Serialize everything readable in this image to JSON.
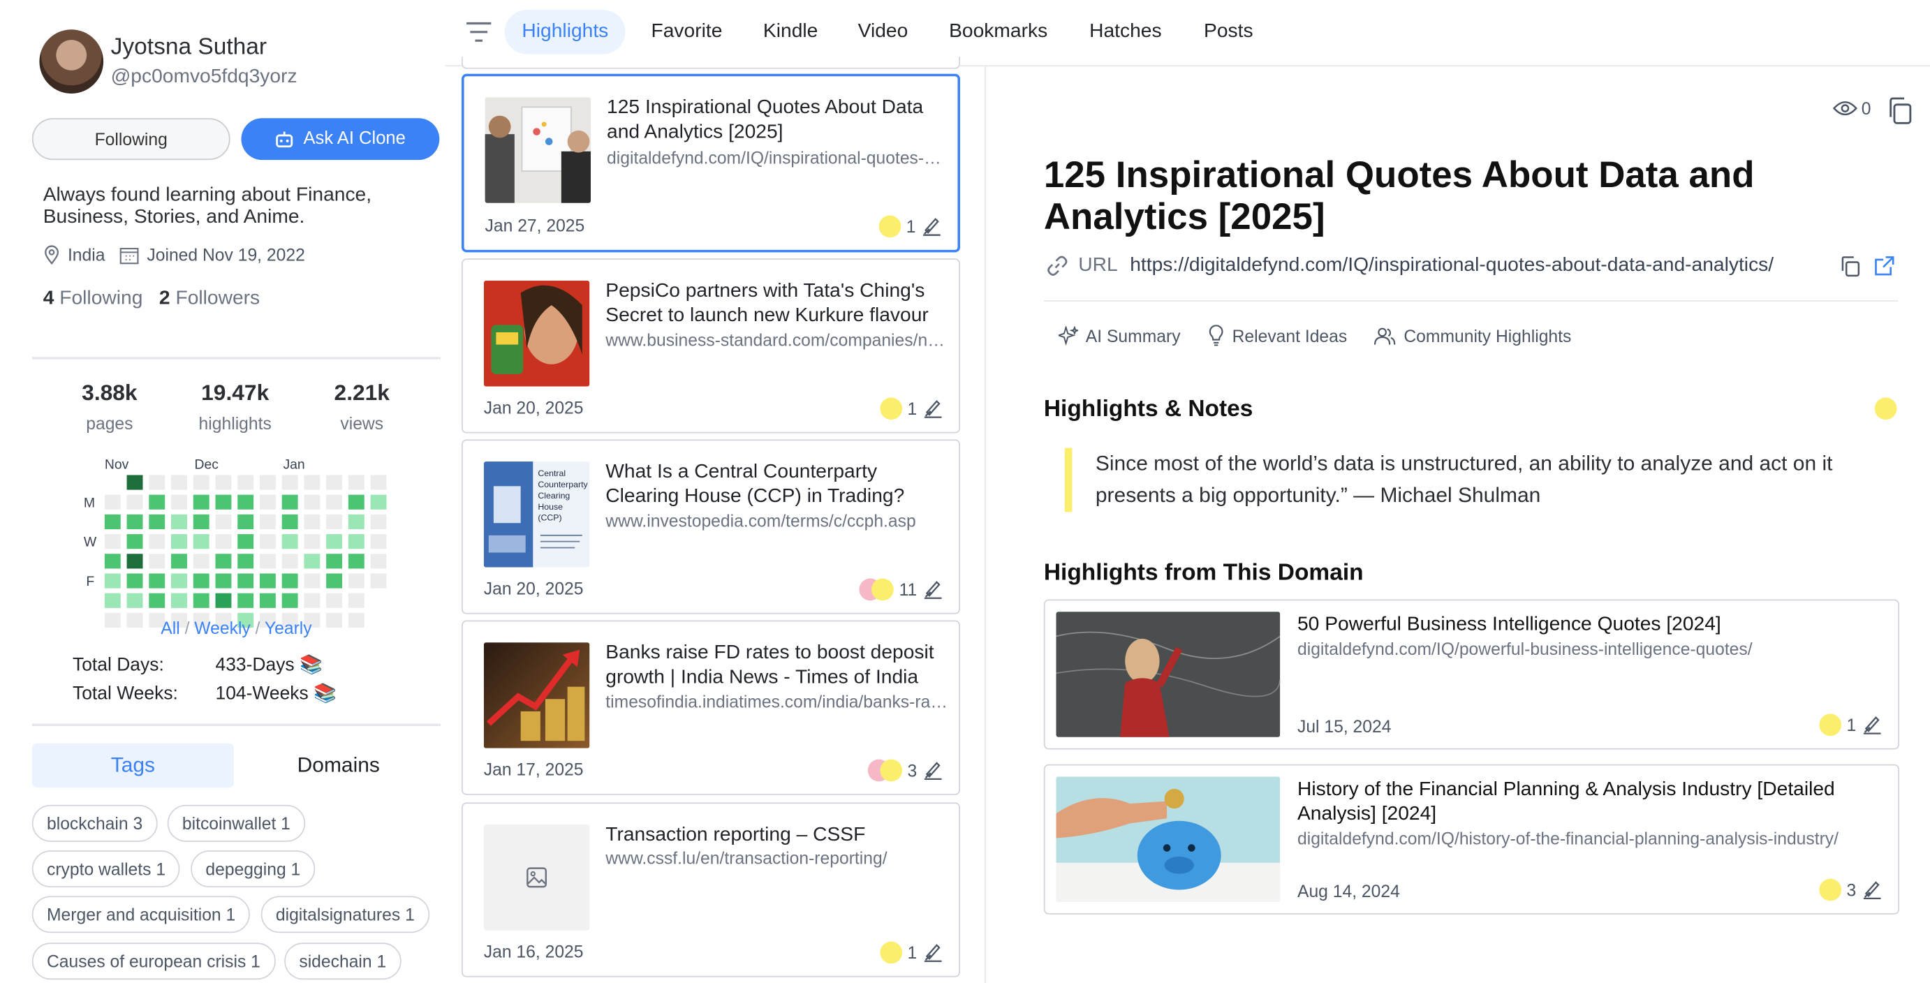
{
  "profile": {
    "name": "Jyotsna Suthar",
    "handle": "@pc0omvo5fdq3yorz",
    "following_btn": "Following",
    "ask_ai_btn": "Ask AI Clone",
    "bio": "Always found learning about Finance, Business, Stories, and Anime.",
    "location": "India",
    "joined": "Joined Nov 19, 2022",
    "following_count": "4",
    "following_label": "Following",
    "followers_count": "2",
    "followers_label": "Followers"
  },
  "stats": [
    {
      "value": "3.88k",
      "label": "pages"
    },
    {
      "value": "19.47k",
      "label": "highlights"
    },
    {
      "value": "2.21k",
      "label": "views"
    }
  ],
  "heatmap": {
    "months": [
      "Nov",
      "Dec",
      "Jan"
    ],
    "days": [
      "M",
      "W",
      "F"
    ],
    "colors": {
      "0": "#ececec",
      "1": "#9ae6b4",
      "2": "#4cc472",
      "3": "#2aa157",
      "4": "#1e6e3c"
    },
    "weeks": [
      [
        -1,
        0,
        2,
        0,
        2,
        1,
        1,
        0
      ],
      [
        4,
        0,
        2,
        2,
        4,
        2,
        1,
        0
      ],
      [
        0,
        2,
        2,
        0,
        0,
        2,
        2,
        0
      ],
      [
        0,
        0,
        1,
        1,
        2,
        1,
        1,
        0
      ],
      [
        0,
        2,
        2,
        1,
        0,
        2,
        2,
        0
      ],
      [
        0,
        2,
        0,
        0,
        2,
        2,
        3,
        0
      ],
      [
        0,
        2,
        2,
        2,
        2,
        2,
        2,
        1
      ],
      [
        0,
        0,
        0,
        0,
        0,
        2,
        2,
        0
      ],
      [
        0,
        2,
        2,
        1,
        0,
        2,
        2,
        0
      ],
      [
        0,
        0,
        0,
        0,
        1,
        0,
        0,
        0
      ],
      [
        0,
        0,
        0,
        1,
        2,
        2,
        0,
        0
      ],
      [
        0,
        2,
        1,
        1,
        2,
        0,
        0,
        0
      ],
      [
        0,
        1,
        0,
        0,
        0,
        0,
        -1,
        -1
      ]
    ]
  },
  "range": {
    "all": "All",
    "weekly": "Weekly",
    "yearly": "Yearly",
    "sep": "/"
  },
  "totals": {
    "days_label": "Total Days:",
    "days_value": "433-Days 📚",
    "weeks_label": "Total Weeks:",
    "weeks_value": "104-Weeks 📚"
  },
  "side_tabs": {
    "tags": "Tags",
    "domains": "Domains"
  },
  "tags": [
    "blockchain 3",
    "bitcoinwallet 1",
    "crypto wallets 1",
    "depegging 1",
    "Merger and acquisition 1",
    "digitalsignatures 1",
    "Causes of european crisis 1",
    "sidechain 1"
  ],
  "nav": [
    "Highlights",
    "Favorite",
    "Kindle",
    "Video",
    "Bookmarks",
    "Hatches",
    "Posts"
  ],
  "articles": [
    {
      "title": "125 Inspirational Quotes About Data and Analytics [2025]",
      "url": "digitaldefynd.com/IQ/inspirational-quotes-about-data-and-analytics/",
      "date": "Jan 27, 2025",
      "count": "1"
    },
    {
      "title": "PepsiCo partners with Tata's Ching's Secret to launch new Kurkure flavour",
      "url": "www.business-standard.com/companies/news/pepsico",
      "date": "Jan 20, 2025",
      "count": "1"
    },
    {
      "title": "What Is a Central Counterparty Clearing House (CCP) in Trading?",
      "url": "www.investopedia.com/terms/c/ccph.asp",
      "date": "Jan 20, 2025",
      "count": "11"
    },
    {
      "title": "Banks raise FD rates to boost deposit growth | India News - Times of India",
      "url": "timesofindia.indiatimes.com/india/banks-raise-fd-rates",
      "date": "Jan 17, 2025",
      "count": "3"
    },
    {
      "title": "Transaction reporting – CSSF",
      "url": "www.cssf.lu/en/transaction-reporting/",
      "date": "Jan 16, 2025",
      "count": "1"
    }
  ],
  "ccp_thumb_text": "Central Counterparty Clearing House (CCP)",
  "detail": {
    "views": "0",
    "title": "125 Inspirational Quotes About Data and Analytics [2025]",
    "url_label": "URL",
    "url": "https://digitaldefynd.com/IQ/inspirational-quotes-about-data-and-analytics/",
    "subtabs": [
      "AI Summary",
      "Relevant Ideas",
      "Community Highlights"
    ],
    "notes_heading": "Highlights & Notes",
    "quote": "Since most of the world’s data is unstructured, an ability to analyze and act on it presents a big opportunity.” — Michael Shulman",
    "domain_heading": "Highlights from This Domain",
    "domain_items": [
      {
        "title": "50 Powerful Business Intelligence Quotes [2024]",
        "url": "digitaldefynd.com/IQ/powerful-business-intelligence-quotes/",
        "date": "Jul 15, 2024",
        "count": "1"
      },
      {
        "title": "History of the Financial Planning & Analysis Industry [Detailed Analysis] [2024]",
        "url": "digitaldefynd.com/IQ/history-of-the-financial-planning-analysis-industry/",
        "date": "Aug 14, 2024",
        "count": "3"
      }
    ]
  },
  "colors": {
    "accent": "#3b82f6",
    "highlight_yellow": "#fbee6d",
    "highlight_pink": "#f6b8c6"
  }
}
